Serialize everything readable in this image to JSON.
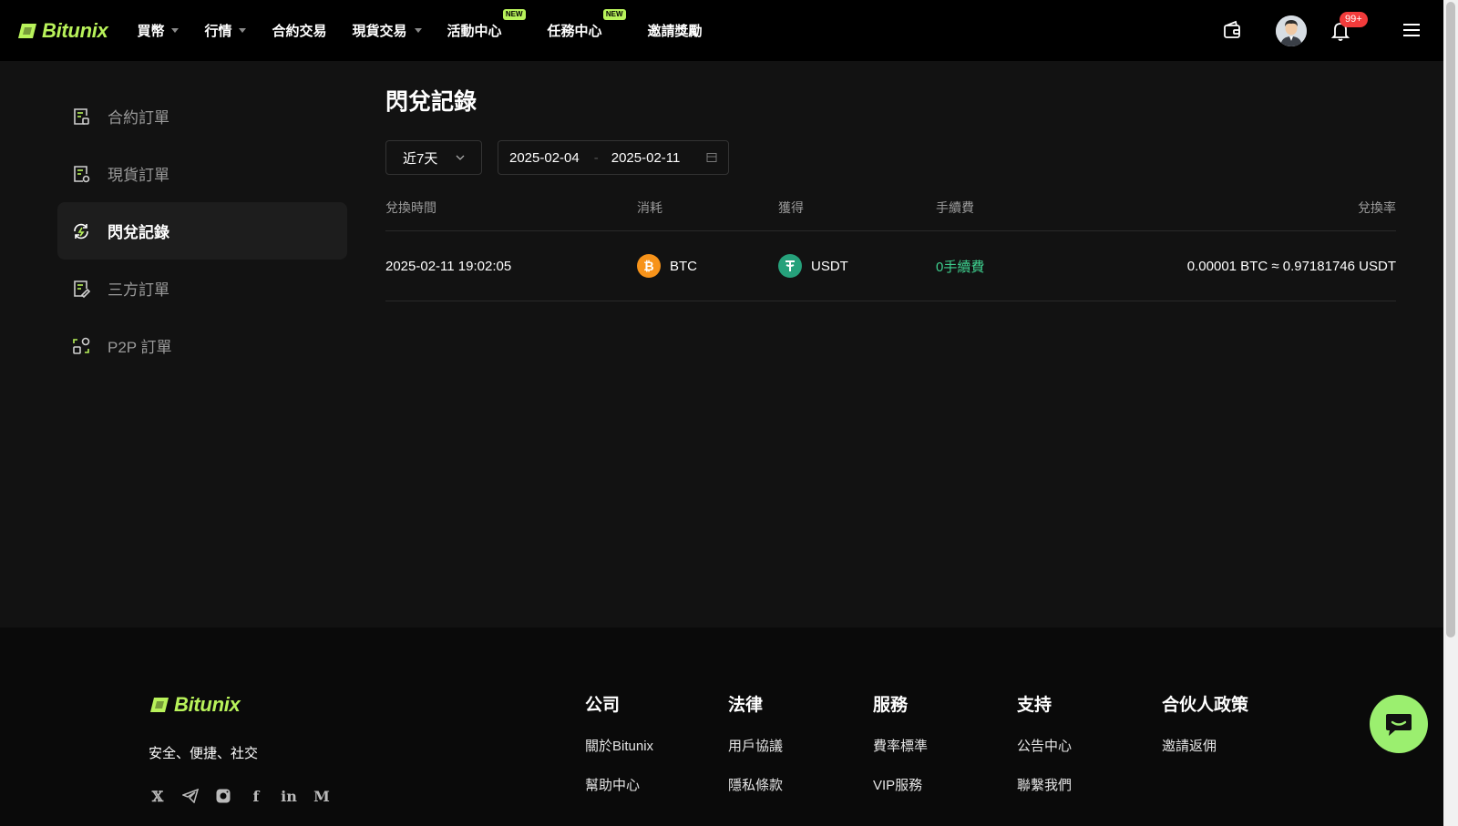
{
  "brand": {
    "name": "Bitunix",
    "color": "#b8f25a"
  },
  "nav": {
    "items": [
      {
        "label": "買幣",
        "dropdown": true,
        "badge": ""
      },
      {
        "label": "行情",
        "dropdown": true,
        "badge": ""
      },
      {
        "label": "合約交易",
        "dropdown": false,
        "badge": ""
      },
      {
        "label": "現貨交易",
        "dropdown": true,
        "badge": ""
      },
      {
        "label": "活動中心",
        "dropdown": false,
        "badge": "NEW"
      },
      {
        "label": "任務中心",
        "dropdown": false,
        "badge": "NEW"
      },
      {
        "label": "邀請獎勵",
        "dropdown": false,
        "badge": ""
      }
    ],
    "notification_count": "99+"
  },
  "sidebar": {
    "items": [
      {
        "label": "合約訂單",
        "icon": "contract-order-icon",
        "active": false
      },
      {
        "label": "現貨訂單",
        "icon": "spot-order-icon",
        "active": false
      },
      {
        "label": "閃兌記錄",
        "icon": "flash-swap-icon",
        "active": true
      },
      {
        "label": "三方訂單",
        "icon": "third-party-order-icon",
        "active": false
      },
      {
        "label": "P2P 訂單",
        "icon": "p2p-order-icon",
        "active": false
      }
    ]
  },
  "main": {
    "title": "閃兌記錄",
    "period": "近7天",
    "date_start": "2025-02-04",
    "date_sep": "-",
    "date_end": "2025-02-11",
    "columns": {
      "time": "兌換時間",
      "cost": "消耗",
      "get": "獲得",
      "fee": "手續費",
      "rate": "兌換率"
    },
    "rows": [
      {
        "time": "2025-02-11 19:02:05",
        "cost_coin": "BTC",
        "get_coin": "USDT",
        "fee": "0手續費",
        "rate": "0.00001 BTC ≈ 0.97181746 USDT"
      }
    ]
  },
  "footer": {
    "slogan": "安全、便捷、社交",
    "columns": [
      {
        "title": "公司",
        "links": [
          "關於Bitunix",
          "幫助中心"
        ]
      },
      {
        "title": "法律",
        "links": [
          "用戶協議",
          "隱私條款"
        ]
      },
      {
        "title": "服務",
        "links": [
          "費率標準",
          "VIP服務"
        ]
      },
      {
        "title": "支持",
        "links": [
          "公告中心",
          "聯繫我們"
        ]
      },
      {
        "title": "合伙人政策",
        "links": [
          "邀請返佣"
        ]
      }
    ],
    "social": [
      "x-icon",
      "telegram-icon",
      "instagram-icon",
      "facebook-icon",
      "linkedin-icon",
      "medium-icon"
    ]
  },
  "colors": {
    "fee_green": "#3ecf8e",
    "btc_orange": "#f7931a",
    "usdt_green": "#26a17b",
    "badge_red": "#f23b3b"
  }
}
